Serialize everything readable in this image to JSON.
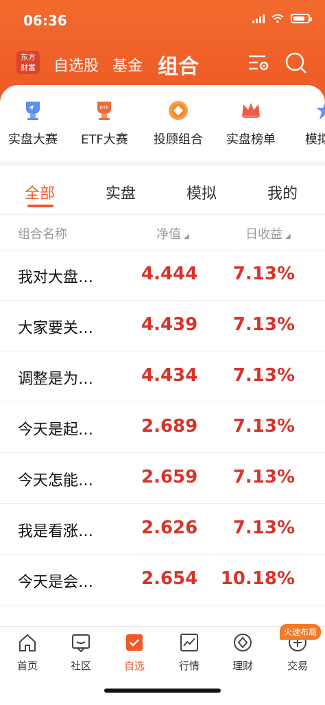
{
  "status": {
    "time": "06:36"
  },
  "appbar": {
    "logo_line1": "东方",
    "logo_line2": "财富",
    "tabs": [
      "自选股",
      "基金",
      "组合"
    ],
    "active_tab": "组合"
  },
  "shortcuts": [
    {
      "label": "实盘大赛",
      "icon": "trophy-icon"
    },
    {
      "label": "ETF大赛",
      "icon": "etf-trophy-icon"
    },
    {
      "label": "投顾组合",
      "icon": "coin-icon"
    },
    {
      "label": "实盘榜单",
      "icon": "crown-icon"
    },
    {
      "label": "模拟",
      "icon": "star-icon"
    }
  ],
  "subtabs": [
    "全部",
    "实盘",
    "模拟",
    "我的"
  ],
  "columns": {
    "name": "组合名称",
    "nav": "净值",
    "ret": "日收益"
  },
  "rows": [
    {
      "name": "我对大盘…",
      "nav": "4.444",
      "ret": "7.13%"
    },
    {
      "name": "大家要关…",
      "nav": "4.439",
      "ret": "7.13%"
    },
    {
      "name": "调整是为…",
      "nav": "4.434",
      "ret": "7.13%"
    },
    {
      "name": "今天是起…",
      "nav": "2.689",
      "ret": "7.13%"
    },
    {
      "name": "今天怎能…",
      "nav": "2.659",
      "ret": "7.13%"
    },
    {
      "name": "我是看涨…",
      "nav": "2.626",
      "ret": "7.13%"
    },
    {
      "name": "今天是会…",
      "nav": "2.654",
      "ret": "10.18%"
    }
  ],
  "tabbar": [
    {
      "label": "首页"
    },
    {
      "label": "社区"
    },
    {
      "label": "自选"
    },
    {
      "label": "行情"
    },
    {
      "label": "理财"
    },
    {
      "label": "交易"
    }
  ],
  "badge": "火速布局",
  "colors": {
    "brand": "#ef5a26",
    "up": "#d8332a"
  }
}
